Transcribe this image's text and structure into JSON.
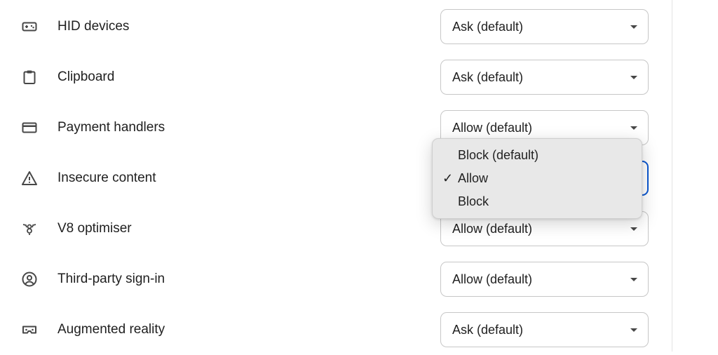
{
  "settings": {
    "rows": [
      {
        "label": "HID devices",
        "value": "Ask (default)",
        "icon": "gamepad-icon"
      },
      {
        "label": "Clipboard",
        "value": "Ask (default)",
        "icon": "clipboard-icon"
      },
      {
        "label": "Payment handlers",
        "value": "Allow (default)",
        "icon": "credit-card-icon"
      },
      {
        "label": "Insecure content",
        "value": "",
        "icon": "warning-icon"
      },
      {
        "label": "V8 optimiser",
        "value": "Allow (default)",
        "icon": "v8-icon"
      },
      {
        "label": "Third-party sign-in",
        "value": "Allow (default)",
        "icon": "account-circle-icon"
      },
      {
        "label": "Augmented reality",
        "value": "Ask (default)",
        "icon": "vr-headset-icon"
      }
    ]
  },
  "dropdown": {
    "options": [
      "Block (default)",
      "Allow",
      "Block"
    ],
    "selected": "Allow",
    "check_glyph": "✓"
  },
  "colors": {
    "focus": "#0b57d0",
    "popup_bg": "#e8e8e8",
    "icon": "#474747"
  }
}
